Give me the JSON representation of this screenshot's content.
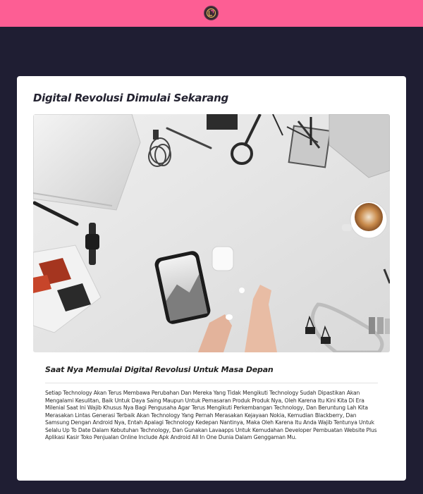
{
  "header": {
    "logo_icon": "brand-logo-icon",
    "background": "#fd5e94"
  },
  "page": {
    "background": "#1f1e33"
  },
  "article": {
    "title": "Digital Revolusi Dimulai Sekarang",
    "image_icon": "flatlay-photo-icon",
    "subtitle": "Saat Nya Memulai Digital Revolusi Untuk Masa Depan",
    "body": "Setiap Technology Akan Terus Membawa Perubahan Dan Mereka Yang Tidak Mengikuti Technology Sudah Dipastikan Akan Mengalami Kesulitan, Baik Untuk Daya Saing Maupun Untuk Pemasaran Produk Produk Nya, Oleh Karena Itu Kini Kita Di Era Milenial Saat Ini Wajib Khusus Nya Bagi Pengusaha Agar Terus Mengikuti Perkembangan Technology, Dan Beruntung Lah Kita Merasakan Lintas Generasi Terbaik Akan Technology Yang Pernah Merasakan Kejayaan Nokia, Kemudian Blackberry, Dan Samsung Dengan Android Nya, Entah Apalagi Technology Kedepan Nantinya, Maka Oleh Karena Itu Anda Wajib Tentunya Untuk Selalu Up To Date Dalam Kebutuhan Technology, Dan Gunakan Lavaapps Untuk Kemudahan Developer Pembuatan Website Plus Aplikasi Kasir Toko Penjualan Online Include Apk Android All In One Dunia Dalam Genggaman Mu."
  }
}
